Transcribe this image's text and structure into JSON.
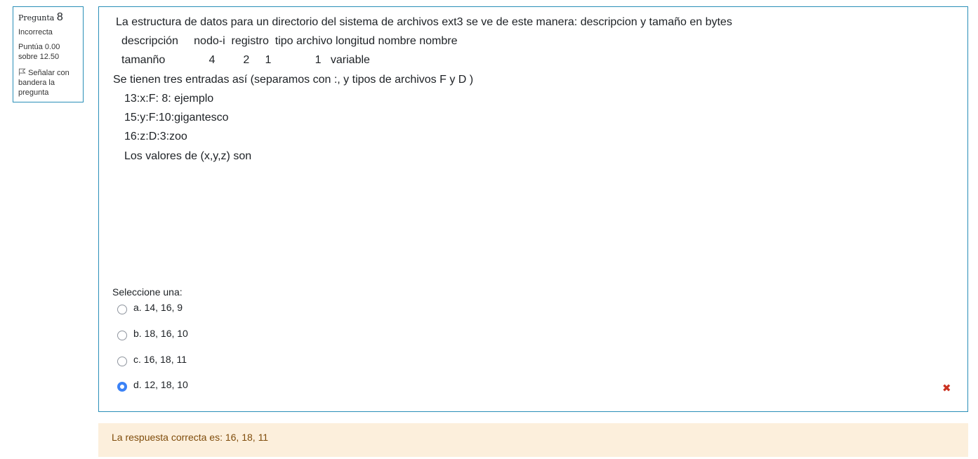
{
  "info": {
    "question_label": "Pregunta",
    "question_number": "8",
    "state": "Incorrecta",
    "grade_line1": "Puntúa 0.00",
    "grade_line2": "sobre 12.50",
    "flag_label": "Señalar con bandera la pregunta",
    "flag_icon": "flag-outline-icon"
  },
  "question": {
    "lines": [
      "La estructura de datos para un directorio del sistema de archivos ext3 se ve de este manera: descripcion y tamaño en bytes",
      "descripción     nodo-i  registro  tipo archivo longitud nombre nombre",
      "tamanño              4         2     1              1   variable",
      "Se tienen tres entradas así (separamos con :, y tipos de archivos F y D )",
      "13:x:F: 8: ejemplo",
      "15:y:F:10:gigantesco",
      "16:z:D:3:zoo",
      "Los valores de (x,y,z) son"
    ]
  },
  "answer": {
    "prompt": "Seleccione una:",
    "options": [
      {
        "label": "a.  14, 16, 9",
        "selected": false
      },
      {
        "label": "b. 18, 16, 10",
        "selected": false
      },
      {
        "label": "c. 16, 18, 11",
        "selected": false
      },
      {
        "label": "d. 12, 18, 10",
        "selected": true
      }
    ],
    "incorrect_icon": "cross-icon",
    "incorrect_color": "#ca3120",
    "selected_color": "#3b82f6"
  },
  "feedback": {
    "right_answer": "La respuesta correcta es: 16, 18, 11"
  },
  "colors": {
    "border": "#2a8fb8",
    "feedback_bg": "#fcefdc",
    "feedback_text": "#7f4c0b"
  }
}
